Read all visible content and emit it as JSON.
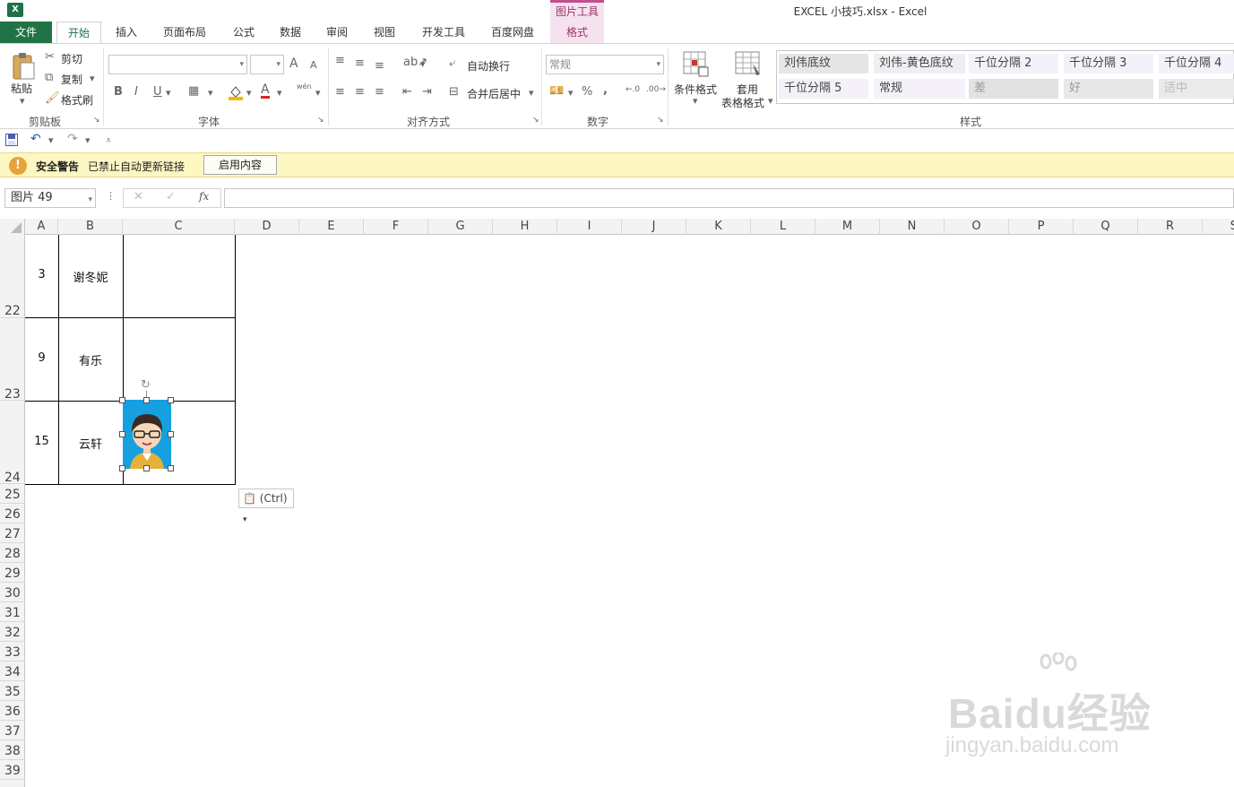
{
  "window": {
    "app_icon": "X",
    "title": "EXCEL 小技巧.xlsx - Excel",
    "context_group": "图片工具"
  },
  "tabs": {
    "file": "文件",
    "items": [
      "开始",
      "插入",
      "页面布局",
      "公式",
      "数据",
      "审阅",
      "视图",
      "开发工具",
      "百度网盘",
      "格式"
    ],
    "active": "开始"
  },
  "ribbon": {
    "clipboard": {
      "paste": "粘贴",
      "cut": "剪切",
      "copy": "复制",
      "format_painter": "格式刷",
      "label": "剪贴板"
    },
    "font": {
      "label": "字体",
      "bold": "B",
      "italic": "I",
      "underline": "U",
      "grow": "A",
      "shrink": "A",
      "color": "A",
      "phonetic": "wén"
    },
    "alignment": {
      "label": "对齐方式",
      "wrap": "自动换行",
      "merge": "合并后居中"
    },
    "number": {
      "label": "数字",
      "format": "常规",
      "percent": "%",
      "comma": ","
    },
    "styles": {
      "label": "样式",
      "conditional": "条件格式",
      "table_format_1": "套用",
      "table_format_2": "表格格式",
      "cells": [
        [
          "刘伟底纹",
          "刘伟-黄色底纹",
          "千位分隔 2",
          "千位分隔 3",
          "千位分隔 4"
        ],
        [
          "千位分隔 5",
          "常规",
          "差",
          "好",
          "适中"
        ]
      ]
    }
  },
  "security_bar": {
    "title": "安全警告",
    "message": "已禁止自动更新链接",
    "button": "启用内容"
  },
  "formula_bar": {
    "name_box": "图片 49",
    "fx": "fx",
    "value": ""
  },
  "grid": {
    "columns": [
      "A",
      "B",
      "C",
      "D",
      "E",
      "F",
      "G",
      "H",
      "I",
      "J",
      "K",
      "L",
      "M",
      "N",
      "O",
      "P",
      "Q",
      "R",
      "S"
    ],
    "rows": [
      "22",
      "23",
      "24",
      "25",
      "26",
      "27",
      "28",
      "29",
      "30",
      "31",
      "32",
      "33",
      "34",
      "35",
      "36",
      "37",
      "38",
      "39"
    ],
    "data": [
      {
        "a": "3",
        "b": "谢冬妮"
      },
      {
        "a": "9",
        "b": "有乐"
      },
      {
        "a": "15",
        "b": "云轩"
      }
    ]
  },
  "paste_options": "(Ctrl)",
  "watermark": {
    "main": "Baidu经验",
    "sub": "jingyan.baidu.com"
  }
}
